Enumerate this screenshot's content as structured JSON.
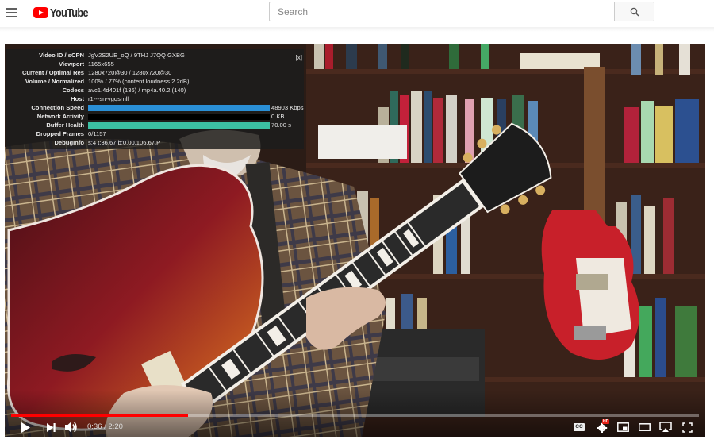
{
  "masthead": {
    "menu_icon": "hamburger-menu-icon",
    "logo_text": "YouTube",
    "search": {
      "placeholder": "Search",
      "value": ""
    },
    "search_icon": "search-icon"
  },
  "stats_for_nerds": {
    "close_label": "[x]",
    "rows": [
      {
        "label": "Video ID / sCPN",
        "value": "JgV2S2UE_oQ / 9THJ J7QQ GXBG"
      },
      {
        "label": "Viewport",
        "value": "1165x655"
      },
      {
        "label": "Current / Optimal Res",
        "value": "1280x720@30 / 1280x720@30"
      },
      {
        "label": "Volume / Normalized",
        "value": "100% / 77% (content loudness 2.2dB)"
      },
      {
        "label": "Codecs",
        "value": "avc1.4d401f (136) / mp4a.40.2 (140)"
      },
      {
        "label": "Host",
        "value": "r1---sn-vgqsrnll"
      }
    ],
    "bars": [
      {
        "label": "Connection Speed",
        "value": "48903 Kbps",
        "fill": 1.0,
        "color": "#2a8fd6"
      },
      {
        "label": "Network Activity",
        "value": "0 KB",
        "fill": 0.0,
        "color": "#000000"
      },
      {
        "label": "Buffer Health",
        "value": "70.00 s",
        "fill": 1.0,
        "color": "#3cbfa3"
      }
    ],
    "tail_rows": [
      {
        "label": "Dropped Frames",
        "value": "0/1157"
      },
      {
        "label": "DebugInfo",
        "value": "s:4 t:36.67 b:0.00,106.67,P"
      }
    ]
  },
  "player": {
    "current_time": "0:36",
    "duration": "2:20",
    "time_display": "0:36 / 2:20",
    "progress_fraction": 0.257,
    "progress_color": "#ff0000",
    "controls": {
      "play": "play-icon",
      "next": "next-icon",
      "volume": "volume-icon",
      "captions": "CC",
      "settings_badge": "HD",
      "miniplayer": "miniplayer-icon",
      "theater": "theater-mode-icon",
      "airplay": "airplay-icon",
      "fullscreen": "fullscreen-icon"
    }
  }
}
